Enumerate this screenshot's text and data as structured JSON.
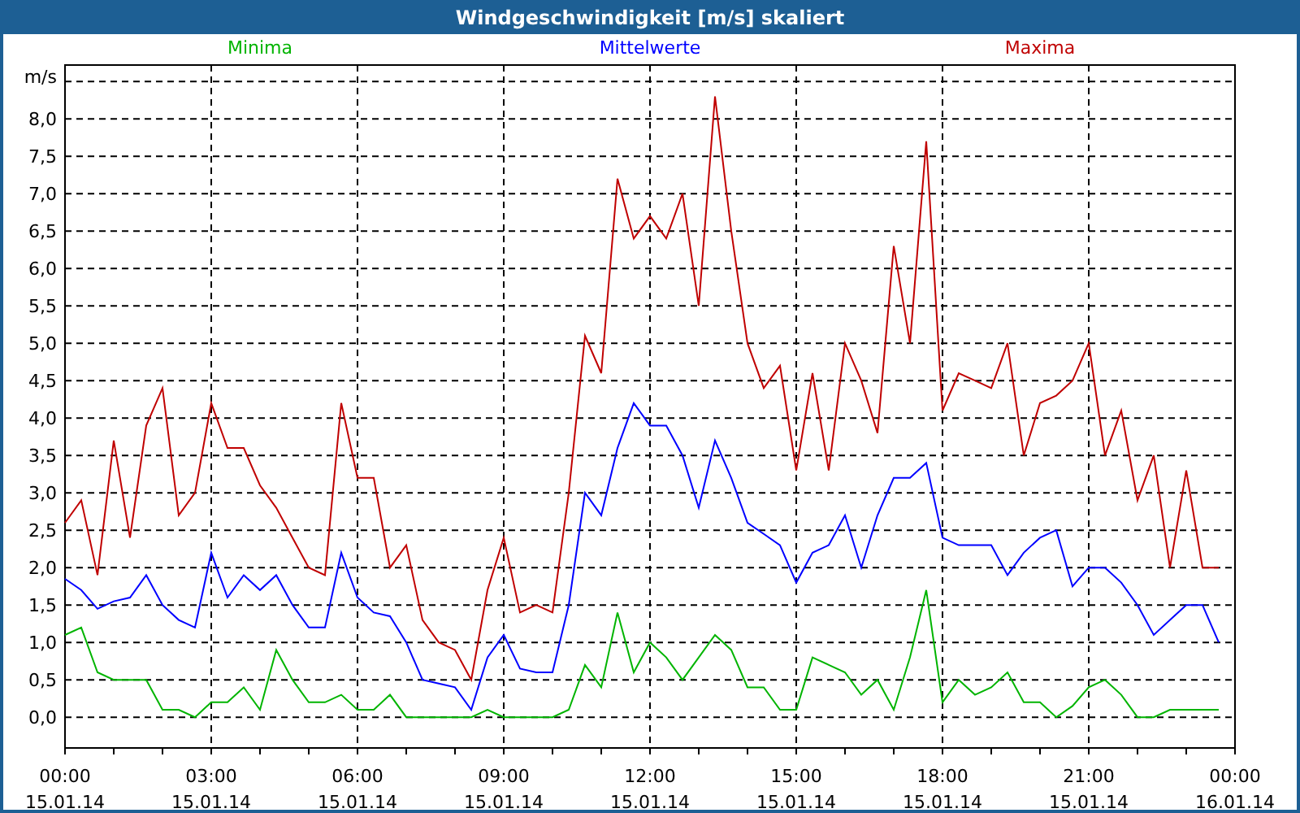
{
  "window": {
    "title": "Windgeschwindigkeit [m/s] skaliert"
  },
  "chart": {
    "chart_data": {
      "type": "line",
      "ylabel": "m/s",
      "grid": true,
      "categories": [
        "00:00\n15.01.14",
        null,
        null,
        null,
        null,
        null,
        null,
        null,
        null,
        "03:00\n15.01.14",
        null,
        null,
        null,
        null,
        null,
        null,
        null,
        null,
        "06:00\n15.01.14",
        null,
        null,
        null,
        null,
        null,
        null,
        null,
        null,
        "09:00\n15.01.14",
        null,
        null,
        null,
        null,
        null,
        null,
        null,
        null,
        "12:00\n15.01.14",
        null,
        null,
        null,
        null,
        null,
        null,
        null,
        null,
        "15:00\n15.01.14",
        null,
        null,
        null,
        null,
        null,
        null,
        null,
        null,
        "18:00\n15.01.14",
        null,
        null,
        null,
        null,
        null,
        null,
        null,
        null,
        "21:00\n15.01.14",
        null,
        null,
        null,
        null,
        null,
        null,
        null,
        null,
        "00:00\n16.01.14"
      ],
      "ylim": [
        -0.41,
        8.72
      ],
      "yticks": [
        {
          "value": 0,
          "label": "0,0"
        },
        {
          "value": 0.5,
          "label": "0,5"
        },
        {
          "value": 1,
          "label": "1,0"
        },
        {
          "value": 1.5,
          "label": "1,5"
        },
        {
          "value": 2,
          "label": "2,0"
        },
        {
          "value": 2.5,
          "label": "2,5"
        },
        {
          "value": 3,
          "label": "3,0"
        },
        {
          "value": 3.5,
          "label": "3,5"
        },
        {
          "value": 4,
          "label": "4,0"
        },
        {
          "value": 4.5,
          "label": "4,5"
        },
        {
          "value": 5,
          "label": "5,0"
        },
        {
          "value": 5.5,
          "label": "5,5"
        },
        {
          "value": 6,
          "label": "6,0"
        },
        {
          "value": 6.5,
          "label": "6,5"
        },
        {
          "value": 7,
          "label": "7,0"
        },
        {
          "value": 7.5,
          "label": "7,5"
        },
        {
          "value": 8,
          "label": "8,0"
        }
      ],
      "series": [
        {
          "name": "Minima",
          "color": "#00b400",
          "values": [
            1.1,
            1.2,
            0.6,
            0.5,
            0.5,
            0.5,
            0.1,
            0.1,
            0,
            0.2,
            0.2,
            0.4,
            0.1,
            0.9,
            0.5,
            0.2,
            0.2,
            0.3,
            0.1,
            0.1,
            0.3,
            0,
            0,
            0,
            0,
            0,
            0.1,
            0,
            0,
            0,
            0,
            0.1,
            0.7,
            0.4,
            1.4,
            0.6,
            1,
            0.8,
            0.5,
            0.8,
            1.1,
            0.9,
            0.4,
            0.4,
            0.1,
            0.1,
            0.8,
            0.7,
            0.6,
            0.3,
            0.5,
            0.1,
            0.8,
            1.7,
            0.2,
            0.5,
            0.3,
            0.4,
            0.6,
            0.2,
            0.2,
            0,
            0.15,
            0.4,
            0.5,
            0.3,
            0,
            0,
            0.1,
            0.1,
            0.1,
            0.1,
            null
          ]
        },
        {
          "name": "Mittelwerte",
          "color": "#0000ff",
          "values": [
            1.85,
            1.7,
            1.45,
            1.55,
            1.6,
            1.9,
            1.5,
            1.3,
            1.2,
            2.2,
            1.6,
            1.9,
            1.7,
            1.9,
            1.5,
            1.2,
            1.2,
            2.2,
            1.6,
            1.4,
            1.35,
            1,
            0.5,
            0.45,
            0.4,
            0.1,
            0.8,
            1.1,
            0.65,
            0.6,
            0.6,
            1.5,
            3,
            2.7,
            3.6,
            4.2,
            3.9,
            3.9,
            3.5,
            2.8,
            3.7,
            3.2,
            2.6,
            2.45,
            2.3,
            1.8,
            2.2,
            2.3,
            2.7,
            2,
            2.7,
            3.2,
            3.2,
            3.4,
            2.4,
            2.3,
            2.3,
            2.3,
            1.9,
            2.2,
            2.4,
            2.5,
            1.75,
            2,
            2,
            1.8,
            1.5,
            1.1,
            1.3,
            1.5,
            1.5,
            1,
            null
          ]
        },
        {
          "name": "Maxima",
          "color": "#c00000",
          "values": [
            2.6,
            2.9,
            1.9,
            3.7,
            2.4,
            3.9,
            4.4,
            2.7,
            3,
            4.2,
            3.6,
            3.6,
            3.1,
            2.8,
            2.4,
            2,
            1.9,
            4.2,
            3.2,
            3.2,
            2,
            2.3,
            1.3,
            1,
            0.9,
            0.5,
            1.7,
            2.4,
            1.4,
            1.5,
            1.4,
            3,
            5.1,
            4.6,
            7.2,
            6.4,
            6.7,
            6.4,
            7,
            5.5,
            8.3,
            6.5,
            5,
            4.4,
            4.7,
            3.3,
            4.6,
            3.3,
            5,
            4.5,
            3.8,
            6.3,
            5,
            7.7,
            4.1,
            4.6,
            4.5,
            4.4,
            5,
            3.5,
            4.2,
            4.3,
            4.5,
            5,
            3.5,
            4.1,
            2.9,
            3.5,
            2,
            3.3,
            2,
            2,
            null
          ]
        }
      ]
    }
  }
}
